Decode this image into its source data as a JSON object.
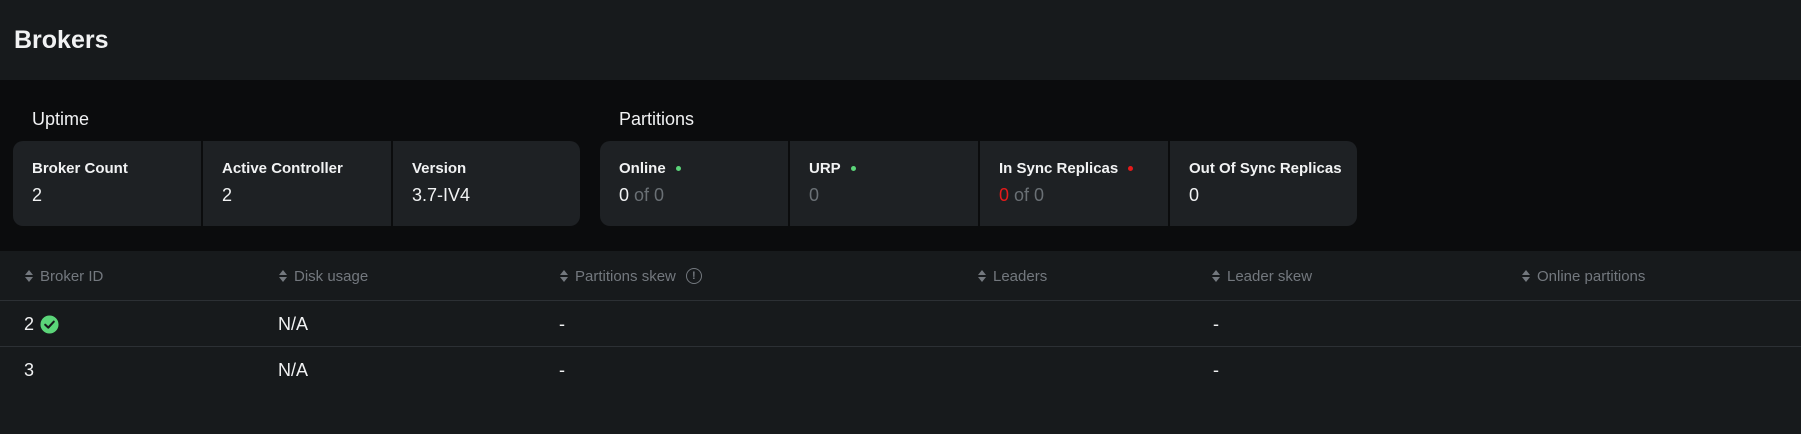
{
  "header": {
    "title": "Brokers"
  },
  "uptime": {
    "title": "Uptime",
    "cards": [
      {
        "label": "Broker Count",
        "value": "2"
      },
      {
        "label": "Active Controller",
        "value": "2"
      },
      {
        "label": "Version",
        "value": "3.7-IV4"
      }
    ]
  },
  "partitions": {
    "title": "Partitions",
    "cards": [
      {
        "label": "Online",
        "status": "green",
        "value": "0",
        "suffix": "of 0"
      },
      {
        "label": "URP",
        "status": "green",
        "value": "0"
      },
      {
        "label": "In Sync Replicas",
        "status": "red",
        "value": "0",
        "suffix": "of 0"
      },
      {
        "label": "Out Of Sync Replicas",
        "value": "0"
      }
    ]
  },
  "table": {
    "columns": [
      "Broker ID",
      "Disk usage",
      "Partitions skew",
      "Leaders",
      "Leader skew",
      "Online partitions"
    ],
    "rows": [
      {
        "broker_id": "2",
        "controller": true,
        "disk_usage": "N/A",
        "partitions_skew": "-",
        "leaders": "",
        "leader_skew": "-",
        "online_partitions": ""
      },
      {
        "broker_id": "3",
        "controller": false,
        "disk_usage": "N/A",
        "partitions_skew": "-",
        "leaders": "",
        "leader_skew": "-",
        "online_partitions": ""
      }
    ]
  },
  "colors": {
    "status_green": "#5bd579",
    "status_red": "#e51a1a",
    "background": "#171a1c",
    "band": "#0b0c0d",
    "card": "#1e2124"
  },
  "icons": {
    "sort": "sort-icon",
    "info": "info-icon",
    "controller": "check-circle-icon"
  }
}
